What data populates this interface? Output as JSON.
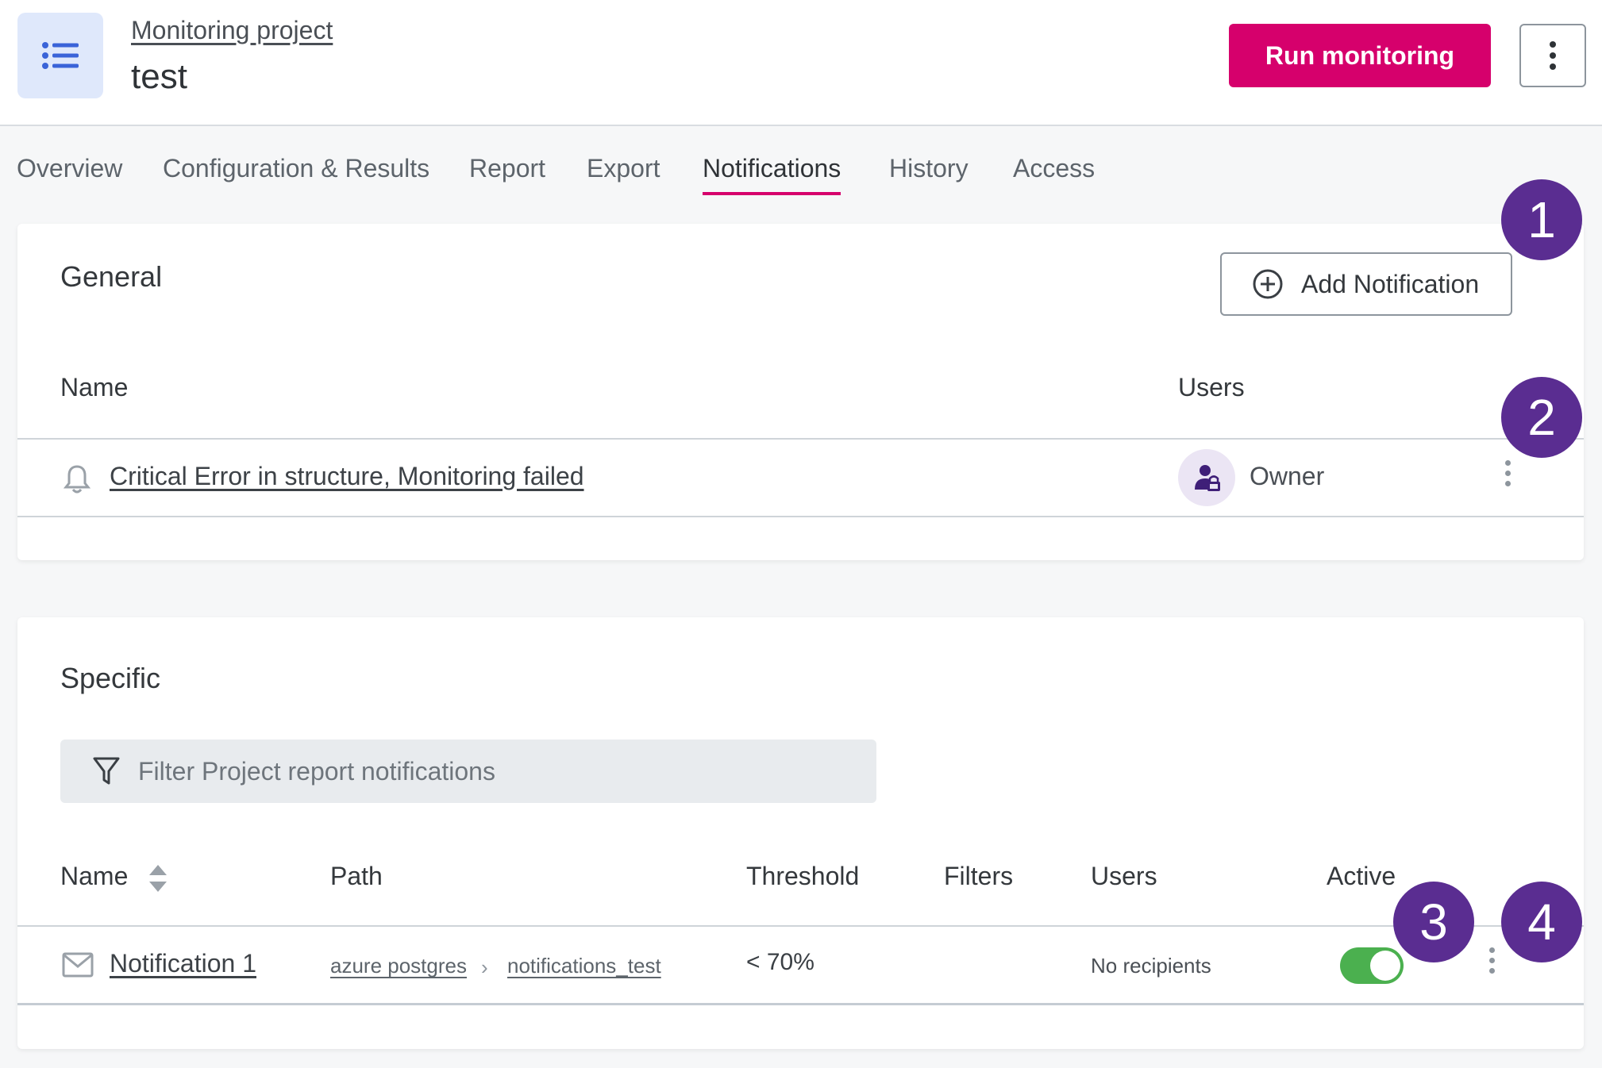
{
  "header": {
    "breadcrumb": "Monitoring project",
    "title": "test",
    "run_button": "Run monitoring"
  },
  "tabs": [
    {
      "label": "Overview",
      "active": false
    },
    {
      "label": "Configuration & Results",
      "active": false
    },
    {
      "label": "Report",
      "active": false
    },
    {
      "label": "Export",
      "active": false
    },
    {
      "label": "Notifications",
      "active": true
    },
    {
      "label": "History",
      "active": false
    },
    {
      "label": "Access",
      "active": false
    }
  ],
  "general": {
    "title": "General",
    "add_button": "Add Notification",
    "columns": {
      "name": "Name",
      "users": "Users"
    },
    "rows": [
      {
        "name": "Critical Error in structure, Monitoring failed",
        "users": "Owner",
        "icon": "bell-icon"
      }
    ]
  },
  "specific": {
    "title": "Specific",
    "filter_placeholder": "Filter Project report notifications",
    "columns": {
      "name": "Name",
      "path": "Path",
      "threshold": "Threshold",
      "filters": "Filters",
      "users": "Users",
      "active": "Active"
    },
    "rows": [
      {
        "name": "Notification 1",
        "path": [
          "azure postgres",
          "notifications_test"
        ],
        "threshold": "< 70%",
        "filters": "",
        "users": "No recipients",
        "active": true,
        "icon": "mail-icon"
      }
    ]
  },
  "callouts": [
    "1",
    "2",
    "3",
    "4"
  ],
  "colors": {
    "accent": "#d6006c",
    "callout": "#5a2d91",
    "toggle_on": "#4bb04f",
    "project_icon_bg": "#dfe8fb"
  }
}
